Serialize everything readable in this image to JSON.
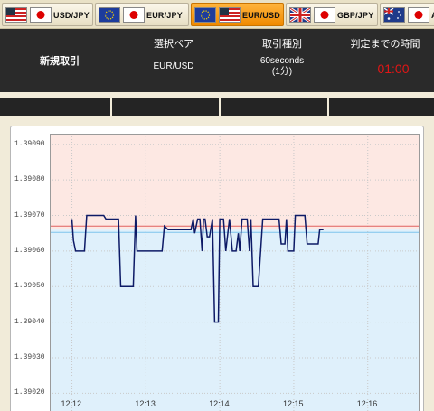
{
  "tabs": [
    {
      "label": "USD/JPY",
      "active": false
    },
    {
      "label": "EUR/JPY",
      "active": false
    },
    {
      "label": "EUR/USD",
      "active": true
    },
    {
      "label": "GBP/JPY",
      "active": false
    },
    {
      "label": "A",
      "active": false
    }
  ],
  "panel": {
    "new_trade": "新規取引",
    "pair_header": "選択ペア",
    "type_header": "取引種別",
    "time_header": "判定までの時間",
    "pair_value": "EUR/USD",
    "type_value_line1": "60seconds",
    "type_value_line2": "(1分)",
    "timer_value": "01:00"
  },
  "colors": {
    "panel_bg": "#2a2a2a",
    "timer": "#e01616",
    "active_tab": "#f08a00",
    "upper_zone": "#fde8e3",
    "lower_zone": "#dff0fb",
    "price_line": "#0d1a66",
    "strike_line_red": "#e06060",
    "strike_line_blue": "#7ec4ec"
  },
  "chart_data": {
    "type": "line",
    "title": "",
    "xlabel": "",
    "ylabel": "",
    "yticks": [
      "1.39090",
      "1.39080",
      "1.39070",
      "1.39060",
      "1.39050",
      "1.39040",
      "1.39030",
      "1.39020"
    ],
    "xticks": [
      "12:12",
      "12:13",
      "12:14",
      "12:15",
      "12:16"
    ],
    "ylim": [
      1.39015,
      1.39093
    ],
    "xlim_minutes": [
      -0.3,
      4.7
    ],
    "strike": 1.39066,
    "series": [
      {
        "x": [
          0.0,
          0.02,
          0.05,
          0.17,
          0.2,
          0.43,
          0.46,
          0.63,
          0.66,
          0.72,
          0.75,
          0.83,
          0.86,
          0.88,
          0.9,
          1.22,
          1.25,
          1.3,
          1.33,
          1.45,
          1.48,
          1.51,
          1.54,
          1.56,
          1.58,
          1.61,
          1.64,
          1.66,
          1.7,
          1.73,
          1.76,
          1.78,
          1.8,
          1.83,
          1.86,
          1.9,
          1.93,
          1.98,
          2.0,
          2.05,
          2.08,
          2.13,
          2.17,
          2.22,
          2.25,
          2.27,
          2.3,
          2.37,
          2.4,
          2.42,
          2.45,
          2.49,
          2.52,
          2.58,
          2.6,
          2.63,
          2.67,
          2.7,
          2.73,
          2.78,
          2.8,
          2.83,
          2.88,
          2.9,
          2.92,
          3.0,
          3.02,
          3.05,
          3.08,
          3.13,
          3.15,
          3.18,
          3.2,
          3.23,
          3.28,
          3.33,
          3.35,
          3.4
        ],
        "y": [
          1.39069,
          1.39063,
          1.3906,
          1.3906,
          1.3907,
          1.3907,
          1.39069,
          1.39069,
          1.3905,
          1.3905,
          1.3905,
          1.3905,
          1.3907,
          1.3906,
          1.3906,
          1.3906,
          1.39067,
          1.39066,
          1.39066,
          1.39066,
          1.39066,
          1.39066,
          1.39066,
          1.39066,
          1.39066,
          1.39066,
          1.39069,
          1.39065,
          1.39069,
          1.39069,
          1.3906,
          1.39069,
          1.39069,
          1.39064,
          1.39064,
          1.39069,
          1.3904,
          1.3904,
          1.39069,
          1.39069,
          1.3906,
          1.39069,
          1.3906,
          1.3906,
          1.39065,
          1.3906,
          1.39069,
          1.39069,
          1.3906,
          1.39069,
          1.3905,
          1.3905,
          1.3905,
          1.39069,
          1.39069,
          1.39069,
          1.39069,
          1.39069,
          1.39069,
          1.39069,
          1.39069,
          1.39062,
          1.39062,
          1.39069,
          1.3906,
          1.3906,
          1.3907,
          1.3907,
          1.3907,
          1.3907,
          1.3907,
          1.39062,
          1.39062,
          1.39062,
          1.39062,
          1.39062,
          1.39066,
          1.39066
        ]
      }
    ],
    "grid": true
  }
}
